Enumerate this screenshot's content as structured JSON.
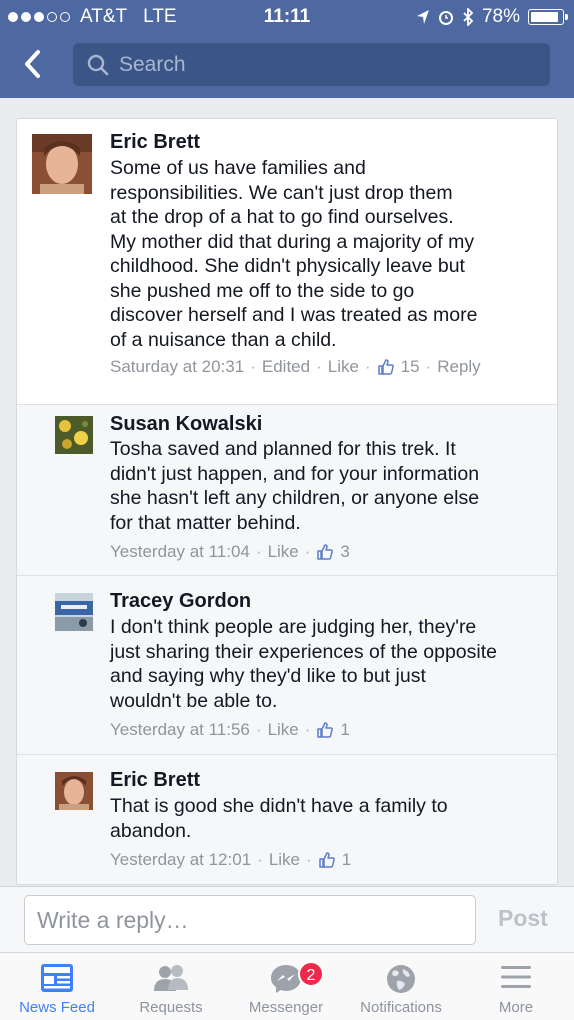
{
  "status_bar": {
    "carrier": "AT&T",
    "network": "LTE",
    "time": "11:11",
    "battery": "78%"
  },
  "search": {
    "placeholder": "Search"
  },
  "comments": [
    {
      "name": "Eric Brett",
      "text": "Some of us have families and\nresponsibilities.  We can't just drop them\nat the drop of a hat to go find ourselves.\nMy mother did that during a majority of my\nchildhood.  She didn't physically leave but\nshe pushed me off to the side to go\ndiscover herself and I was treated as more\nof a nuisance than a child.",
      "timestamp": "Saturday at 20:31",
      "edited": "Edited",
      "like": "Like",
      "likes": "15",
      "reply": "Reply"
    }
  ],
  "replies": [
    {
      "name": "Susan Kowalski",
      "text": "Tosha saved and planned for this trek. It\ndidn't just happen, and for your information\nshe hasn't left any children, or anyone else\nfor that matter behind.",
      "timestamp": "Yesterday at 11:04",
      "like": "Like",
      "likes": "3"
    },
    {
      "name": "Tracey Gordon",
      "text": "I don't think people are judging her, they're\njust sharing their experiences of the opposite\nand saying why they'd like to but just\nwouldn't be able to.",
      "timestamp": "Yesterday at 11:56",
      "like": "Like",
      "likes": "1"
    },
    {
      "name": "Eric Brett",
      "text": "That is good she didn't have a family to\nabandon.",
      "timestamp": "Yesterday at 12:01",
      "like": "Like",
      "likes": "1"
    }
  ],
  "reply_bar": {
    "placeholder": "Write a reply…",
    "post": "Post"
  },
  "tabs": [
    {
      "label": "News Feed",
      "icon": "news-feed-icon"
    },
    {
      "label": "Requests",
      "icon": "friend-requests-icon"
    },
    {
      "label": "Messenger",
      "icon": "messenger-icon",
      "badge": "2"
    },
    {
      "label": "Notifications",
      "icon": "globe-icon"
    },
    {
      "label": "More",
      "icon": "menu-icon"
    }
  ],
  "colors": {
    "header": "#4e69a2",
    "active_tab": "#4080ff",
    "badge": "#f02849"
  }
}
